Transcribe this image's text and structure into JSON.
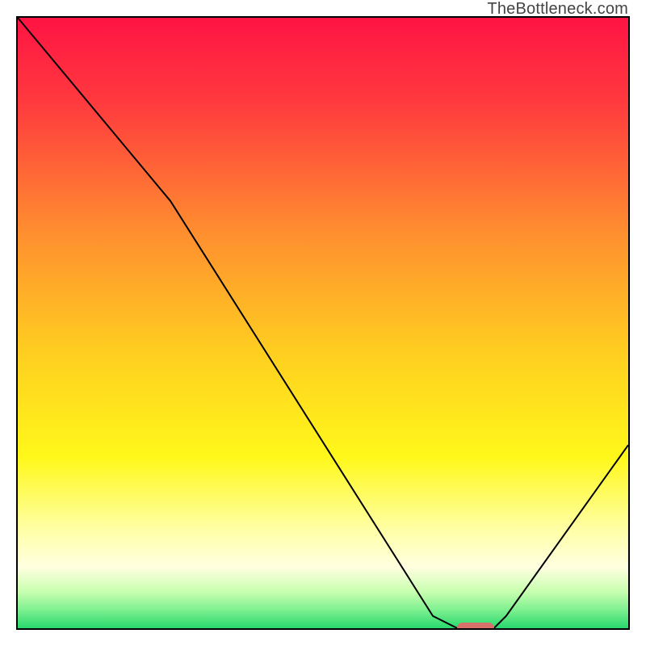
{
  "attribution": "TheBottleneck.com",
  "colors": {
    "frame_border": "#000000",
    "curve": "#000000",
    "marker": "#d9716b",
    "gradient_stops": [
      {
        "pct": 0,
        "hex": "#ff1444"
      },
      {
        "pct": 14,
        "hex": "#ff3a3e"
      },
      {
        "pct": 34,
        "hex": "#ff8a30"
      },
      {
        "pct": 55,
        "hex": "#ffcf20"
      },
      {
        "pct": 72,
        "hex": "#fff81a"
      },
      {
        "pct": 84,
        "hex": "#ffffa8"
      },
      {
        "pct": 90,
        "hex": "#ffffe0"
      },
      {
        "pct": 94,
        "hex": "#c8ffb0"
      },
      {
        "pct": 97,
        "hex": "#7ef090"
      },
      {
        "pct": 100,
        "hex": "#28d86e"
      }
    ]
  },
  "chart_data": {
    "type": "line",
    "title": "",
    "xlabel": "",
    "ylabel": "",
    "xlim": [
      0,
      100
    ],
    "ylim": [
      0,
      100
    ],
    "grid": false,
    "curve_points": [
      {
        "x": 0,
        "y": 100
      },
      {
        "x": 25,
        "y": 70
      },
      {
        "x": 68,
        "y": 2
      },
      {
        "x": 72,
        "y": 0
      },
      {
        "x": 78,
        "y": 0
      },
      {
        "x": 80,
        "y": 2
      },
      {
        "x": 100,
        "y": 30
      }
    ],
    "marker": {
      "x_start": 72,
      "x_end": 78,
      "y": 0
    },
    "note": "x and y are normalized 0–100 percent of the plot area; y=0 is bottom"
  }
}
